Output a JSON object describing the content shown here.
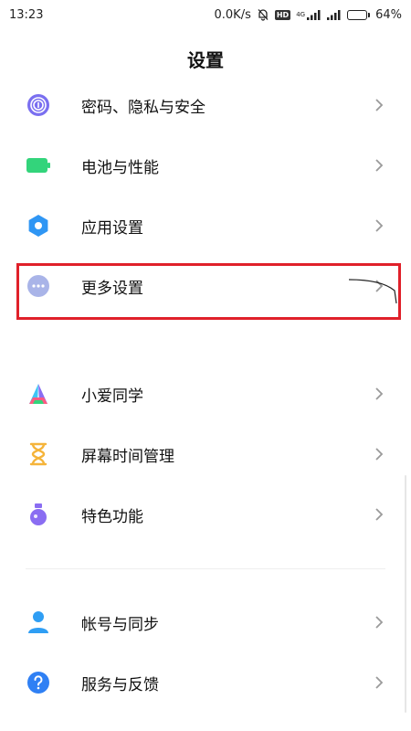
{
  "status_bar": {
    "time": "13:23",
    "speed": "0.0K/s",
    "hd": "HD",
    "network": "4G",
    "battery_pct_text": "64%",
    "battery_level": 0.64
  },
  "page": {
    "title": "设置"
  },
  "items": [
    {
      "label": "密码、隐私与安全",
      "icon": "fingerprint-icon",
      "color": "#7a6ff0"
    },
    {
      "label": "电池与性能",
      "icon": "battery-icon",
      "color": "#33d47b"
    },
    {
      "label": "应用设置",
      "icon": "gear-icon",
      "color": "#2f96f4"
    },
    {
      "label": "更多设置",
      "icon": "more-dots-icon",
      "color": "#a9b4e8"
    },
    {
      "label": "小爱同学",
      "icon": "xiaoai-icon",
      "color": "#ff5a82"
    },
    {
      "label": "屏幕时间管理",
      "icon": "hourglass-icon",
      "color": "#f5b43a"
    },
    {
      "label": "特色功能",
      "icon": "flask-icon",
      "color": "#8a6df2"
    },
    {
      "label": "帐号与同步",
      "icon": "person-icon",
      "color": "#2f9ef4"
    },
    {
      "label": "服务与反馈",
      "icon": "help-icon",
      "color": "#2f80f4"
    }
  ],
  "colors": {
    "highlight": "#e0202a",
    "chevron": "#9a9a9a"
  }
}
